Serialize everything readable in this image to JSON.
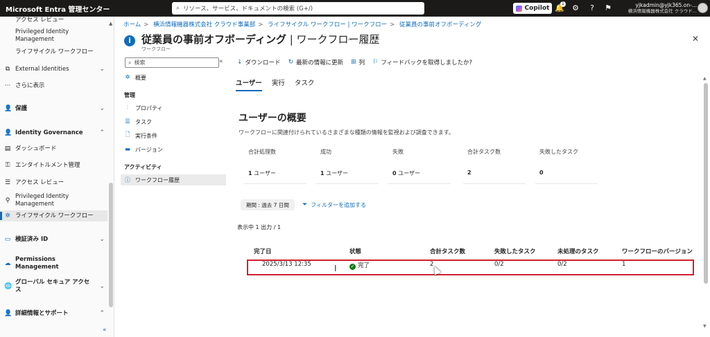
{
  "topbar": {
    "brand": "Microsoft Entra 管理センター",
    "search_placeholder": "リソース、サービス、ドキュメントの検索 (G+/)",
    "copilot_label": "Copilot",
    "notification_count": "1",
    "account_name": "yjkadmin@yjk365.on-...",
    "account_org": "横浜情報機器株式会社  クラウド..."
  },
  "leftnav": {
    "items": [
      {
        "label": "アクセス レビュー",
        "icon": "review-icon"
      },
      {
        "label": "Privileged Identity Management",
        "icon": "pim-icon"
      },
      {
        "label": "ライフサイクル ワークフロー",
        "icon": "lifecycle-icon"
      },
      {
        "label": "External Identities",
        "icon": "external-icon"
      },
      {
        "label": "さらに表示",
        "icon": "more-icon"
      },
      {
        "label": "保護",
        "icon": "protect-icon"
      },
      {
        "label": "Identity Governance",
        "icon": "governance-icon"
      },
      {
        "label": "ダッシュボード",
        "icon": "dashboard-icon"
      },
      {
        "label": "エンタイトルメント管理",
        "icon": "entitlement-icon"
      },
      {
        "label": "アクセス レビュー",
        "icon": "review-icon"
      },
      {
        "label": "Privileged Identity Management",
        "icon": "pim-icon"
      },
      {
        "label": "ライフサイクル ワークフロー",
        "icon": "lifecycle-icon"
      },
      {
        "label": "検証済み ID",
        "icon": "verified-id-icon"
      },
      {
        "label": "Permissions Management",
        "icon": "permissions-icon"
      },
      {
        "label": "グローバル セキュア アクセス",
        "icon": "global-access-icon"
      },
      {
        "label": "詳細情報とサポート",
        "icon": "support-icon"
      }
    ]
  },
  "breadcrumb": [
    "ホーム",
    "横浜情報機器株式会社 クラウド事業部",
    "ライフサイクル ワークフロー | ワークフロー",
    "従業員の事前オフボーディング"
  ],
  "header": {
    "title_main": "従業員の事前オフボーディング",
    "title_rest": " | ワークフロー履歴",
    "subtitle": "ワークフロー",
    "more": "...",
    "close": "✕"
  },
  "inner_menu": {
    "search_placeholder": "検索",
    "overview": "概要",
    "section_manage": "管理",
    "properties": "プロパティ",
    "tasks": "タスク",
    "conditions": "実行条件",
    "versions": "バージョン",
    "section_activity": "アクティビティ",
    "history": "ワークフロー履歴"
  },
  "toolbar": {
    "download": "ダウンロード",
    "refresh": "最新の情報に更新",
    "columns": "列",
    "feedback": "フィードバックを取得しましたか?"
  },
  "tabs": [
    "ユーザー",
    "実行",
    "タスク"
  ],
  "summary": {
    "title": "ユーザーの概要",
    "description": "ワークフローに関連付けられているさまざまな種類の情報を監視および調査できます。",
    "cards": [
      {
        "label": "合計処理数",
        "value": "1",
        "unit": " ユーザー"
      },
      {
        "label": "成功",
        "value": "1",
        "unit": " ユーザー"
      },
      {
        "label": "失敗",
        "value": "0",
        "unit": " ユーザー"
      },
      {
        "label": "合計タスク数",
        "value": "2",
        "unit": ""
      },
      {
        "label": "失敗したタスク",
        "value": "0",
        "unit": ""
      }
    ]
  },
  "filters": {
    "period": "期間 : 過去 7 日間",
    "add_filter": "フィルターを追加する"
  },
  "count_text": "表示中 1 出力 / 1",
  "table": {
    "headers": [
      "完了日",
      "状態",
      "合計タスク数",
      "失敗したタスク",
      "未処理のタスク",
      "ワークフローのバージョン"
    ],
    "rows": [
      {
        "date": "2025/3/13 12:35",
        "status": "完了",
        "total": "2",
        "failed": "0/2",
        "pending": "0/2",
        "version": "1"
      }
    ]
  },
  "colors": {
    "accent": "#0f6cbd",
    "success": "#107c10",
    "highlight": "#d0202e"
  }
}
